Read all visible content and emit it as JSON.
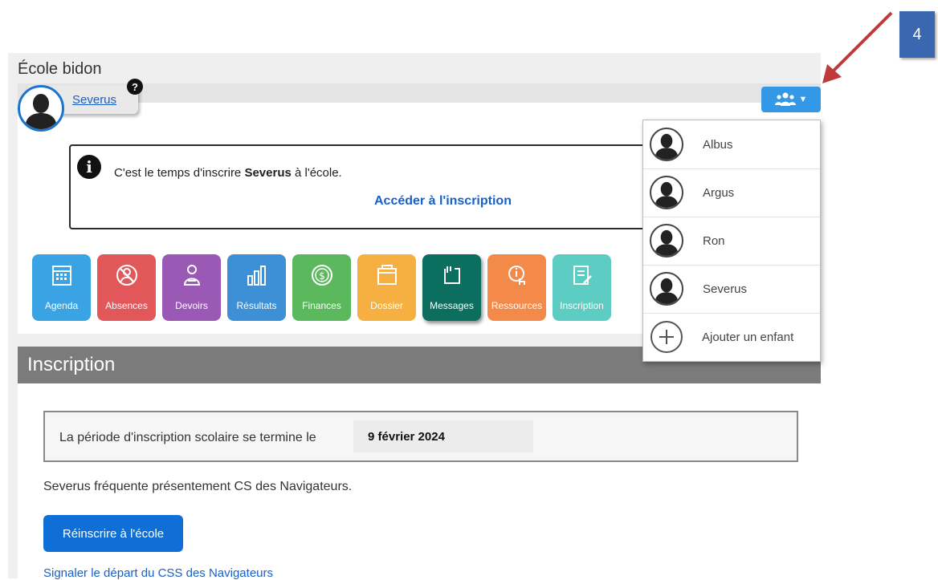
{
  "step_badge": "4",
  "header": {
    "school_name": "École bidon",
    "user_name": "Severus",
    "help_symbol": "?"
  },
  "notice": {
    "text_before": "C'est le temps d'inscrire ",
    "child": "Severus",
    "text_after": " à l'école.",
    "link": "Accéder à l'inscription"
  },
  "tiles": [
    {
      "label": "Agenda",
      "color": "#3aa3e3",
      "icon": "calendar-icon"
    },
    {
      "label": "Absences",
      "color": "#e2585a",
      "icon": "absence-icon"
    },
    {
      "label": "Devoirs",
      "color": "#9b59b6",
      "icon": "homework-icon"
    },
    {
      "label": "Résultats",
      "color": "#3d8fd6",
      "icon": "bar-chart-icon"
    },
    {
      "label": "Finances",
      "color": "#5cb85c",
      "icon": "dollar-icon"
    },
    {
      "label": "Dossier",
      "color": "#f5b041",
      "icon": "folder-icon"
    },
    {
      "label": "Messages",
      "color": "#0b6e5f",
      "icon": "message-icon"
    },
    {
      "label": "Ressources",
      "color": "#f48a4a",
      "icon": "resources-icon"
    },
    {
      "label": "Inscription",
      "color": "#5dcdc3",
      "icon": "registration-icon"
    }
  ],
  "section": {
    "title": "Inscription",
    "period_label": "La période d'inscription scolaire se termine le",
    "period_date": "9 février 2024",
    "attending_text": "Severus fréquente présentement CS des Navigateurs.",
    "reenroll_button": "Réinscrire à l'école",
    "departure_link": "Signaler le départ du CSS des Navigateurs"
  },
  "children_menu": {
    "items": [
      "Albus",
      "Argus",
      "Ron",
      "Severus"
    ],
    "add_child": "Ajouter un enfant"
  },
  "colors": {
    "accent": "#1b75d0",
    "section_header": "#7b7b7b",
    "arrow": "#c0393b"
  }
}
